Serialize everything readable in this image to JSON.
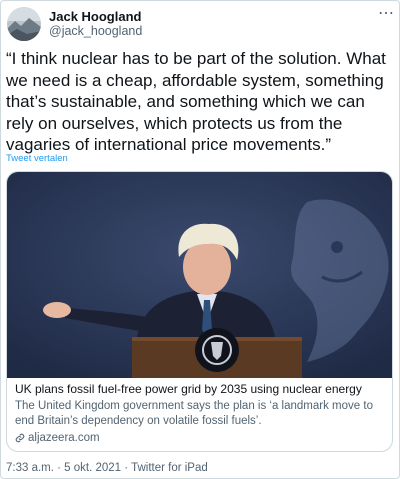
{
  "author": {
    "display_name": "Jack Hoogland",
    "handle": "@jack_hoogland"
  },
  "more_icon": "more-options-icon",
  "tweet": {
    "text": "“I think nuclear has to be part of the solution. What we need is a cheap, affordable system, something that’s sustainable, and something which we can rely on ourselves, which protects us from the vagaries of international price movements.”",
    "translate_label": "Tweet vertalen"
  },
  "card": {
    "title": "UK plans fossil fuel-free power grid by 2035 using nuclear energy",
    "description": "The United Kingdom government says the plan is ‘a landmark move to end Britain’s dependency on volatile fossil fuels’.",
    "domain": "aljazeera.com",
    "domain_icon": "link-icon"
  },
  "meta": {
    "text": "7:33 a.m. · 5 okt. 2021 · Twitter for iPad"
  },
  "colors": {
    "link": "#1d9bf0",
    "secondary_text": "#536471",
    "border": "#cfd9de",
    "photo_background": "#2d3b5c"
  }
}
